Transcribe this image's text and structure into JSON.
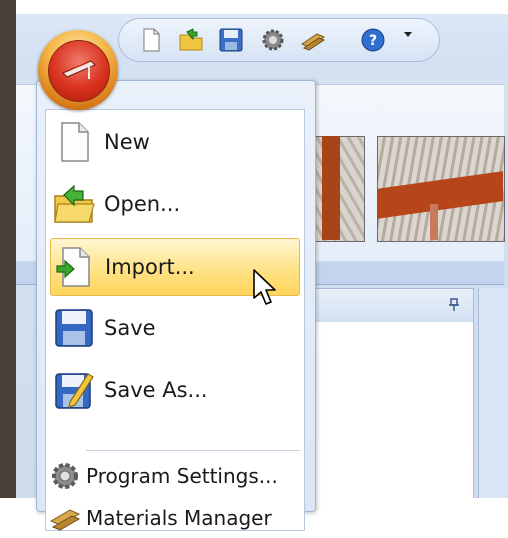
{
  "quick_access_toolbar": {
    "icons": [
      "new-document-icon",
      "open-folder-icon",
      "save-icon",
      "settings-gear-icon",
      "materials-icon",
      "help-icon"
    ]
  },
  "app_menu": {
    "items": [
      {
        "label": "New",
        "icon": "new-document-icon"
      },
      {
        "label": "Open...",
        "icon": "open-folder-icon"
      },
      {
        "label": "Import...",
        "icon": "import-icon",
        "highlighted": true
      },
      {
        "label": "Save",
        "icon": "save-icon"
      },
      {
        "label": "Save As...",
        "icon": "save-as-icon"
      }
    ],
    "secondary_items": [
      {
        "label": "Program Settings...",
        "icon": "settings-gear-icon"
      },
      {
        "label": "Materials Manager",
        "icon": "materials-icon"
      }
    ]
  },
  "colors": {
    "highlight": "#ffe388",
    "app_button_orange": "#f6b94a",
    "app_button_red": "#d8321e"
  }
}
